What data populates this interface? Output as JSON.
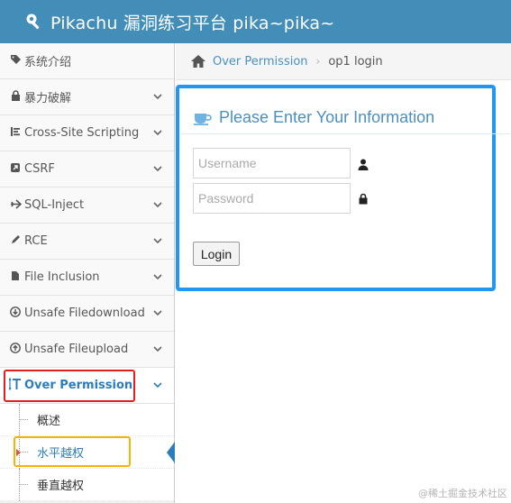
{
  "header": {
    "title": "Pikachu 漏洞练习平台 pika~pika~"
  },
  "sidebar": {
    "items": [
      {
        "label": "系统介绍",
        "icon": "tag-icon",
        "has_chevron": false
      },
      {
        "label": "暴力破解",
        "icon": "lock-icon",
        "has_chevron": true
      },
      {
        "label": "Cross-Site Scripting",
        "icon": "list-icon",
        "has_chevron": true
      },
      {
        "label": "CSRF",
        "icon": "external-link-icon",
        "has_chevron": true
      },
      {
        "label": "SQL-Inject",
        "icon": "plane-icon",
        "has_chevron": true
      },
      {
        "label": "RCE",
        "icon": "pencil-icon",
        "has_chevron": true
      },
      {
        "label": "File Inclusion",
        "icon": "file-icon",
        "has_chevron": true
      },
      {
        "label": "Unsafe Filedownload",
        "icon": "download-circle-icon",
        "has_chevron": true
      },
      {
        "label": "Unsafe Fileupload",
        "icon": "upload-circle-icon",
        "has_chevron": true
      },
      {
        "label": "Over Permission",
        "icon": "text-height-icon",
        "has_chevron": true,
        "active": true
      }
    ],
    "subitems": [
      {
        "label": "概述"
      },
      {
        "label": "水平越权",
        "current": true
      },
      {
        "label": "垂直越权"
      }
    ]
  },
  "breadcrumb": {
    "link": "Over Permission",
    "current": "op1 login"
  },
  "panel": {
    "title": "Please Enter Your Information",
    "username_placeholder": "Username",
    "password_placeholder": "Password",
    "login_label": "Login"
  },
  "watermark": "@稀土掘金技术社区",
  "colors": {
    "header": "#438eb9",
    "accent": "#2b7dbc",
    "highlight_red": "#e02020",
    "highlight_yellow": "#f4b400",
    "panel_border": "#2196f3"
  }
}
